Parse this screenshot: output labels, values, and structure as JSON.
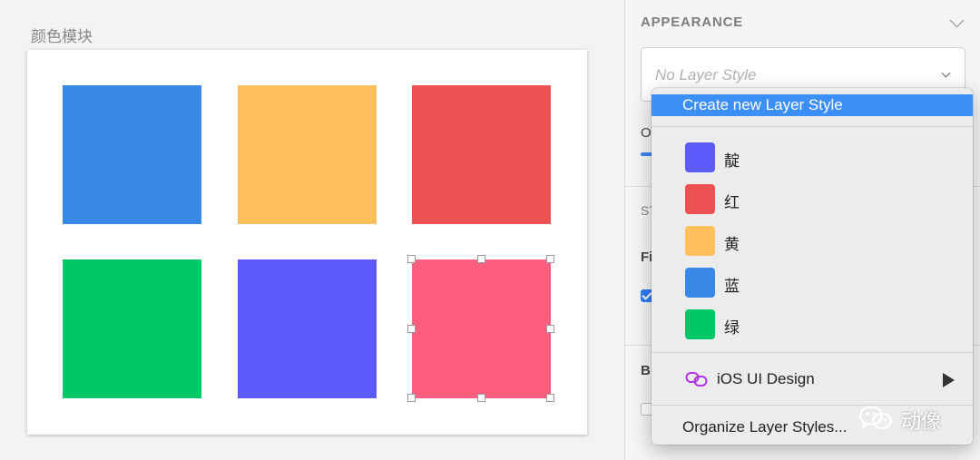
{
  "canvas": {
    "artboard_title": "颜色模块",
    "swatches": [
      {
        "name": "blue",
        "color": "#3889e7"
      },
      {
        "name": "yellow",
        "color": "#fdc05b"
      },
      {
        "name": "red",
        "color": "#ee5152"
      },
      {
        "name": "green",
        "color": "#00c767"
      },
      {
        "name": "indigo",
        "color": "#5d5bfc"
      },
      {
        "name": "pink",
        "color": "#ff5d7f",
        "selected": true
      }
    ]
  },
  "panel": {
    "section_title": "APPEARANCE",
    "layer_style_value": "No Layer Style",
    "cut_labels": [
      "O",
      "ST",
      "Fi",
      "B"
    ]
  },
  "menu": {
    "create_label": "Create new Layer Style",
    "color_styles": [
      {
        "label": "靛",
        "color": "#5d5bfc"
      },
      {
        "label": "红",
        "color": "#ee5152"
      },
      {
        "label": "黄",
        "color": "#fdc05b"
      },
      {
        "label": "蓝",
        "color": "#3889e7"
      },
      {
        "label": "绿",
        "color": "#00c767"
      }
    ],
    "library_label": "iOS UI Design",
    "organize_label": "Organize Layer Styles..."
  },
  "watermark": {
    "text": "动像"
  },
  "colors": {
    "accent": "#3c8ff7",
    "library_icon": "#b232e8"
  }
}
